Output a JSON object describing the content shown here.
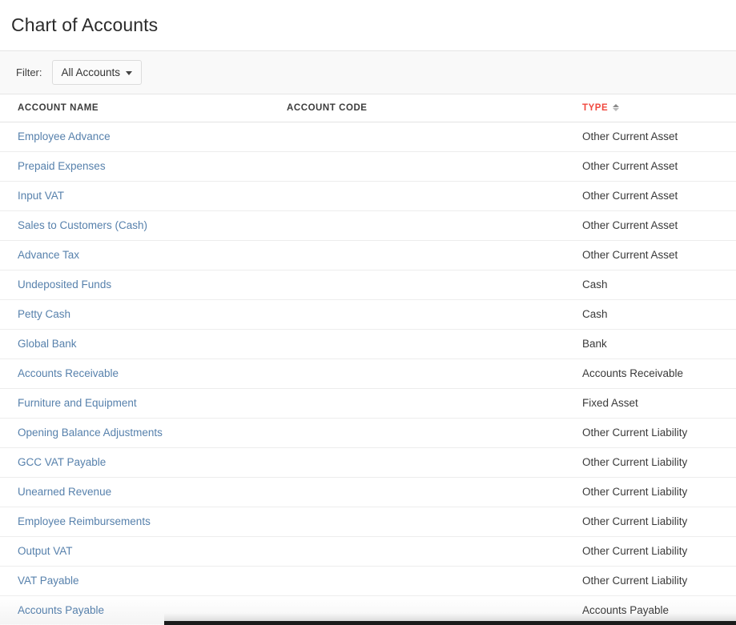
{
  "header": {
    "title": "Chart of Accounts"
  },
  "filter": {
    "label": "Filter:",
    "selected": "All Accounts",
    "caret_icon": "chevron-down-icon"
  },
  "table": {
    "columns": [
      {
        "key": "name",
        "label": "ACCOUNT NAME",
        "sorted": false
      },
      {
        "key": "code",
        "label": "ACCOUNT CODE",
        "sorted": false
      },
      {
        "key": "type",
        "label": "TYPE",
        "sorted": true,
        "sort_direction": "asc",
        "sort_icon": "sort-ascending-icon"
      }
    ],
    "sorted_column_color": "#f0483e",
    "link_color": "#5781ac",
    "rows": [
      {
        "name": "Employee Advance",
        "code": "",
        "type": "Other Current Asset"
      },
      {
        "name": "Prepaid Expenses",
        "code": "",
        "type": "Other Current Asset"
      },
      {
        "name": "Input VAT",
        "code": "",
        "type": "Other Current Asset"
      },
      {
        "name": "Sales to Customers (Cash)",
        "code": "",
        "type": "Other Current Asset"
      },
      {
        "name": "Advance Tax",
        "code": "",
        "type": "Other Current Asset"
      },
      {
        "name": "Undeposited Funds",
        "code": "",
        "type": "Cash"
      },
      {
        "name": "Petty Cash",
        "code": "",
        "type": "Cash"
      },
      {
        "name": "Global Bank",
        "code": "",
        "type": "Bank"
      },
      {
        "name": "Accounts Receivable",
        "code": "",
        "type": "Accounts Receivable"
      },
      {
        "name": "Furniture and Equipment",
        "code": "",
        "type": "Fixed Asset"
      },
      {
        "name": "Opening Balance Adjustments",
        "code": "",
        "type": "Other Current Liability"
      },
      {
        "name": "GCC VAT Payable",
        "code": "",
        "type": "Other Current Liability"
      },
      {
        "name": "Unearned Revenue",
        "code": "",
        "type": "Other Current Liability"
      },
      {
        "name": "Employee Reimbursements",
        "code": "",
        "type": "Other Current Liability"
      },
      {
        "name": "Output VAT",
        "code": "",
        "type": "Other Current Liability"
      },
      {
        "name": "VAT Payable",
        "code": "",
        "type": "Other Current Liability"
      },
      {
        "name": "Accounts Payable",
        "code": "",
        "type": "Accounts Payable",
        "hovered": true
      }
    ]
  }
}
